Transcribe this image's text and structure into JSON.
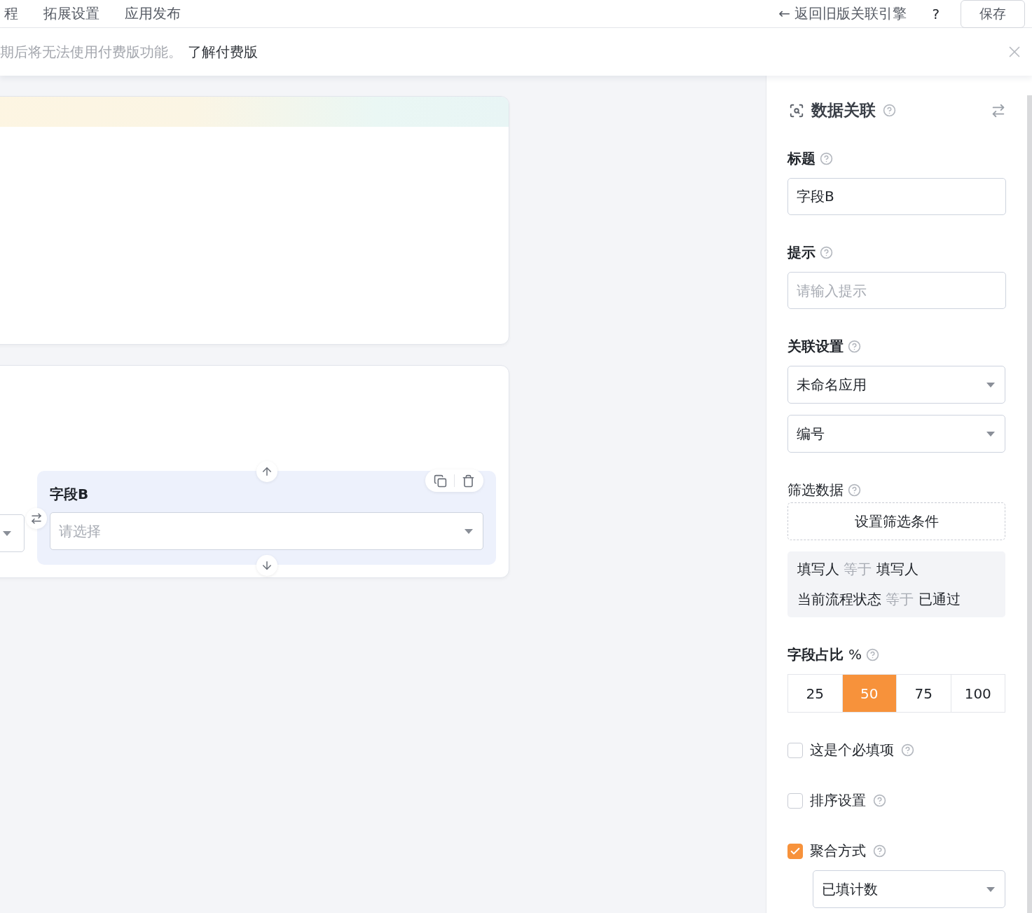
{
  "top_nav": {
    "tabs": [
      {
        "label": "程"
      },
      {
        "label": "拓展设置"
      },
      {
        "label": "应用发布"
      }
    ],
    "back_link": "← 返回旧版关联引擎",
    "help": "?",
    "save_button": "保存"
  },
  "notice": {
    "text": "期后将无法使用付费版功能。",
    "link": "了解付费版"
  },
  "canvas": {
    "field": {
      "label": "字段B",
      "placeholder": "请选择"
    }
  },
  "panel": {
    "title": "数据关联",
    "title_field": {
      "label": "标题",
      "value": "字段B"
    },
    "hint_field": {
      "label": "提示",
      "placeholder": "请输入提示"
    },
    "link_settings": {
      "label": "关联设置",
      "selects": [
        "未命名应用",
        "编号"
      ]
    },
    "filter": {
      "label": "筛选数据",
      "button": "设置筛选条件",
      "conditions": [
        {
          "field": "填写人",
          "operator": "等于",
          "value": "填写人"
        },
        {
          "field": "当前流程状态",
          "operator": "等于",
          "value": "已通过"
        }
      ]
    },
    "width": {
      "label": "字段占比",
      "unit": "%",
      "options": [
        {
          "label": "25",
          "selected": false
        },
        {
          "label": "50",
          "selected": true
        },
        {
          "label": "75",
          "selected": false
        },
        {
          "label": "100",
          "selected": false
        }
      ]
    },
    "options": [
      {
        "label": "这是个必填项",
        "checked": false
      },
      {
        "label": "排序设置",
        "checked": false
      },
      {
        "label": "聚合方式",
        "checked": true
      }
    ],
    "aggregation": "已填计数"
  }
}
